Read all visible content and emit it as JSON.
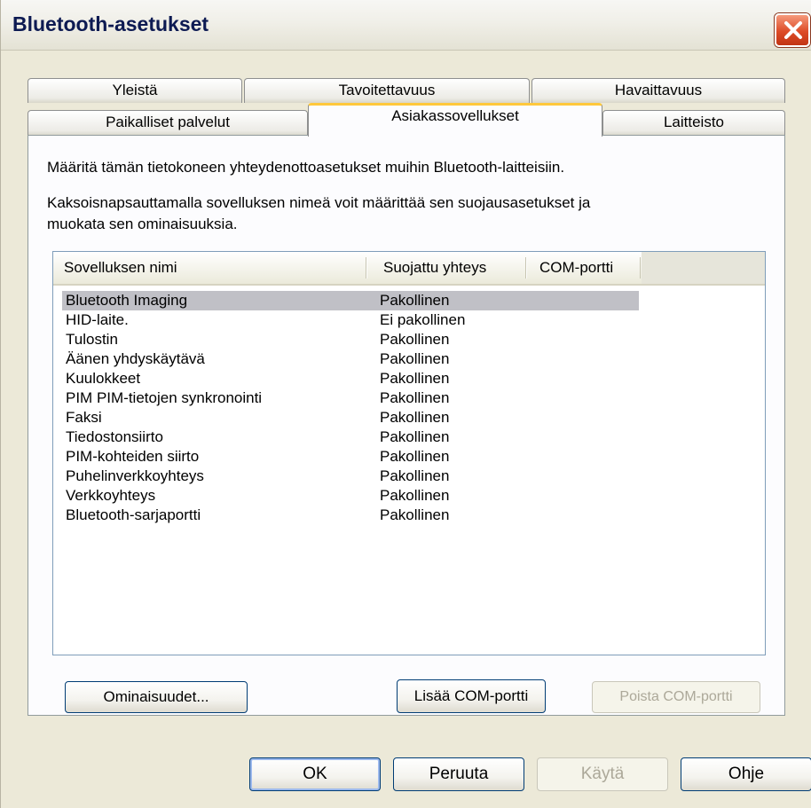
{
  "window": {
    "title": "Bluetooth-asetukset"
  },
  "icons": {
    "close": "close-icon"
  },
  "tabs_row1": [
    {
      "label": "Yleistä"
    },
    {
      "label": "Tavoitettavuus"
    },
    {
      "label": "Havaittavuus"
    }
  ],
  "tabs_row2": [
    {
      "label": "Paikalliset palvelut"
    },
    {
      "label": "Asiakassovellukset",
      "active": true
    },
    {
      "label": "Laitteisto"
    }
  ],
  "panel": {
    "description1": "Määritä tämän tietokoneen yhteydenottoasetukset muihin Bluetooth-laitteisiin.",
    "description2a": "Kaksoisnapsauttamalla sovelluksen nimeä voit määrittää sen suojausasetukset ja",
    "description2b": "muokata sen ominaisuuksia."
  },
  "table": {
    "headers": [
      "Sovelluksen nimi",
      "Suojattu yhteys",
      "COM-portti"
    ],
    "rows": [
      {
        "name": "Bluetooth Imaging",
        "secure": "Pakollinen",
        "selected": true
      },
      {
        "name": "HID-laite.",
        "secure": "Ei pakollinen"
      },
      {
        "name": "Tulostin",
        "secure": "Pakollinen"
      },
      {
        "name": "Äänen yhdyskäytävä",
        "secure": "Pakollinen"
      },
      {
        "name": "Kuulokkeet",
        "secure": "Pakollinen"
      },
      {
        "name": "PIM PIM-tietojen synkronointi",
        "secure": "Pakollinen"
      },
      {
        "name": "Faksi",
        "secure": "Pakollinen"
      },
      {
        "name": "Tiedostonsiirto",
        "secure": "Pakollinen"
      },
      {
        "name": "PIM-kohteiden siirto",
        "secure": "Pakollinen"
      },
      {
        "name": "Puhelinverkkoyhteys",
        "secure": "Pakollinen"
      },
      {
        "name": "Verkkoyhteys",
        "secure": "Pakollinen"
      },
      {
        "name": "Bluetooth-sarjaportti",
        "secure": "Pakollinen"
      }
    ]
  },
  "panel_buttons": {
    "properties": "Ominaisuudet...",
    "add_com": "Lisää COM-portti",
    "remove_com": "Poista COM-portti"
  },
  "dialog_buttons": {
    "ok": "OK",
    "cancel": "Peruuta",
    "apply": "Käytä",
    "help": "Ohje"
  }
}
